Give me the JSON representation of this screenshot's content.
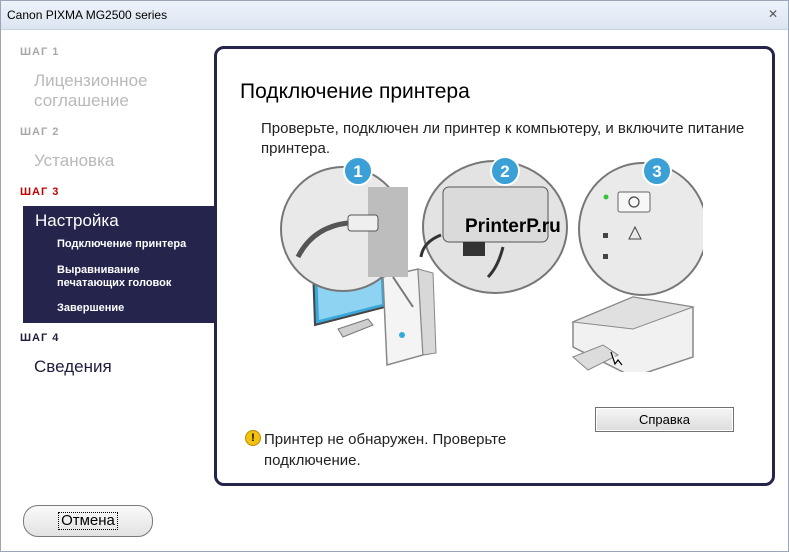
{
  "window": {
    "title": "Canon PIXMA MG2500 series",
    "close_glyph": "✕"
  },
  "sidebar": {
    "steps": [
      {
        "label": "ШАГ 1",
        "title_lines": [
          "Лицензионное",
          "соглашение"
        ]
      },
      {
        "label": "ШАГ 2",
        "title": "Установка"
      },
      {
        "label": "ШАГ 3",
        "title": "Настройка",
        "subitems": [
          "Подключение принтера",
          "Выравнивание печатающих головок",
          "Завершение"
        ],
        "subitem_lines": [
          [
            "Подключение принтера"
          ],
          [
            "Выравнивание",
            "печатающих головок"
          ],
          [
            "Завершение"
          ]
        ]
      },
      {
        "label": "ШАГ 4",
        "title": "Сведения"
      }
    ]
  },
  "content": {
    "heading": "Подключение принтера",
    "instruction": "Проверьте, подключен ли принтер к компьютеру, и включите питание принтера.",
    "illustration": {
      "callouts": [
        "1",
        "2",
        "3"
      ],
      "watermark": "PrinterP.ru",
      "icons": [
        "usb-cable-icon",
        "computer-icon",
        "printer-icon",
        "power-icon",
        "warning-light-icon"
      ]
    },
    "help_button": "Справка",
    "warning": {
      "icon": "warning-icon",
      "glyph": "!",
      "text": "Принтер не обнаружен. Проверьте подключение."
    }
  },
  "footer": {
    "cancel_button": "Отмена"
  },
  "colors": {
    "panel": "#24244d",
    "current_step": "#c00000",
    "inactive_text": "#b9b9b9"
  }
}
